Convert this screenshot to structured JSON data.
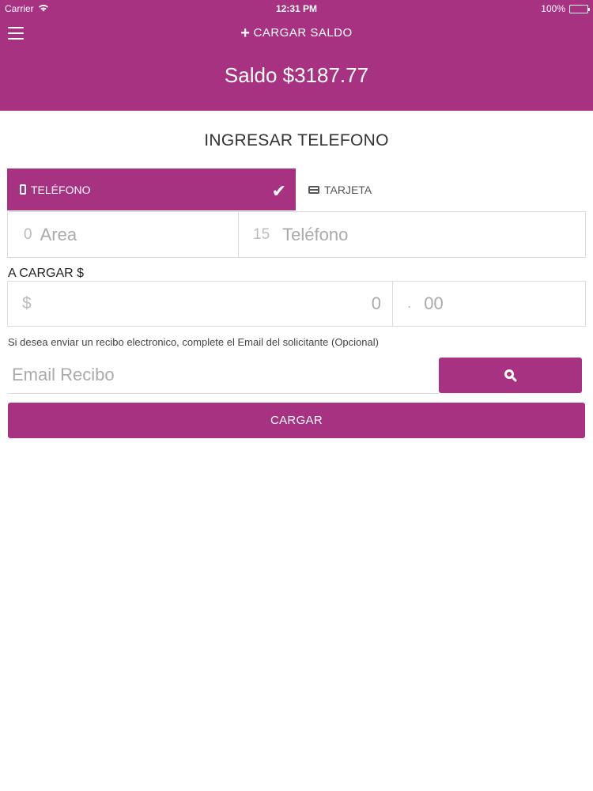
{
  "status_bar": {
    "carrier": "Carrier",
    "time": "12:31 PM",
    "battery": "100%"
  },
  "header": {
    "nav_icon": "hamburger-menu-icon",
    "title_icon": "plus-icon",
    "title": "CARGAR SALDO",
    "balance": "Saldo $3187.77",
    "background_color": "#a83282"
  },
  "main": {
    "section_title": "INGRESAR TELEFONO",
    "tabs": [
      {
        "label": "TELÉFONO",
        "icon": "phone-icon",
        "active": true,
        "check_icon": "checkmark-icon"
      },
      {
        "label": "TARJETA",
        "icon": "credit-card-icon",
        "active": false
      }
    ],
    "phone_inputs": {
      "area_prefix": "0",
      "area_placeholder": "Area",
      "phone_prefix": "15",
      "phone_placeholder": "Teléfono"
    },
    "amount": {
      "label": "A CARGAR $",
      "currency_prefix": "$",
      "integer_placeholder": "0",
      "decimal_separator": ".",
      "decimal_placeholder": "00"
    },
    "email": {
      "help_text": "Si desea enviar un recibo electronico, complete el Email del solicitante (Opcional)",
      "placeholder": "Email Recibo",
      "search_icon": "search-icon"
    },
    "submit_label": "CARGAR"
  }
}
